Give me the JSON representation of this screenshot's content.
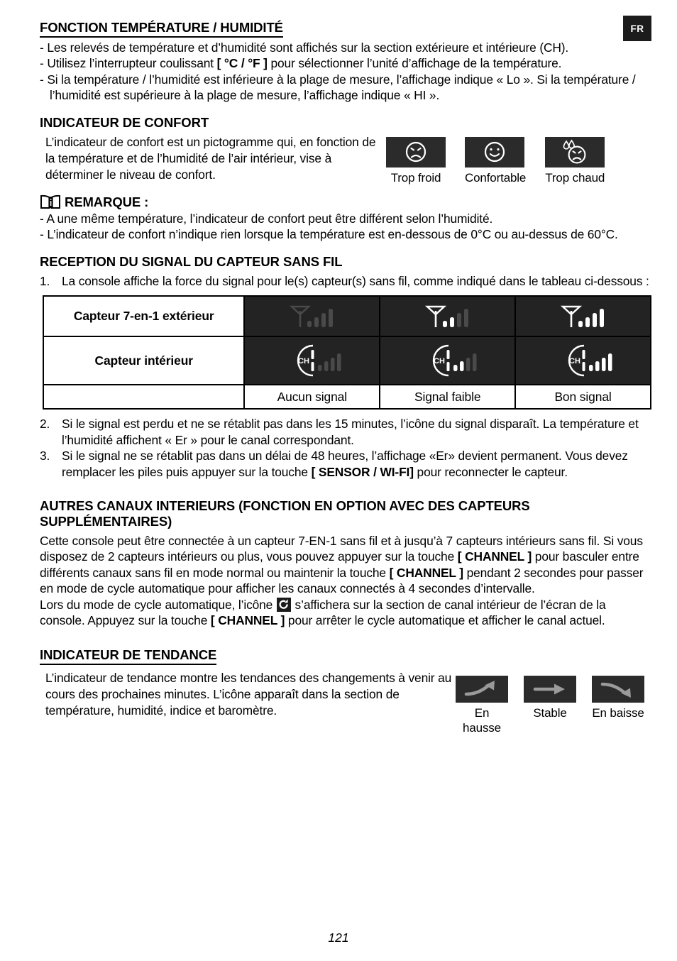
{
  "lang_badge": "FR",
  "page_number": "121",
  "temp_humidity": {
    "heading": "FONCTION TEMPÉRATURE / HUMIDITÉ",
    "bullets": [
      {
        "pre": "- Les relevés de température et d’humidité sont affichés sur la section extérieure et intérieure (CH).",
        "bold": "",
        "post": ""
      },
      {
        "pre": "- Utilisez l’interrupteur coulissant ",
        "bold": "[ °C / °F ]",
        "post": " pour sélectionner l’unité d’affichage de la température."
      },
      {
        "pre": "- Si la température / l’humidité est inférieure à la plage de mesure, l’affichage indique « Lo ». Si la température / l’humidité est supérieure à la plage de mesure, l’affichage indique « HI ».",
        "bold": "",
        "post": ""
      }
    ]
  },
  "comfort": {
    "heading": "INDICATEUR DE CONFORT",
    "description": "L’indicateur de confort est un pictogramme qui, en fonction de la température et de l’humidité de l’air intérieur, vise à déterminer le niveau de confort.",
    "items": [
      {
        "icon": "sad-face-icon",
        "label": "Trop froid"
      },
      {
        "icon": "happy-face-icon",
        "label": "Confortable"
      },
      {
        "icon": "sad-face-sweat-icon",
        "label": "Trop chaud"
      }
    ]
  },
  "remarque": {
    "icon": "manual-book-info-icon",
    "title": "REMARQUE :",
    "bullets": [
      "- A une même température, l’indicateur de confort peut être différent selon l’humidité.",
      "- L’indicateur de confort n’indique rien lorsque la température est en-dessous de 0°C ou au-dessus de 60°C."
    ]
  },
  "signal_reception": {
    "heading": "RECEPTION DU SIGNAL DU CAPTEUR SANS FIL",
    "items": [
      {
        "num": "1.",
        "pre": "La console affiche la force du signal pour le(s) capteur(s) sans fil, comme indiqué dans le tableau ci-dessous :",
        "bold": "",
        "post": ""
      },
      {
        "num": "2.",
        "pre": "Si le signal est perdu et ne se rétablit pas dans les 15 minutes, l’icône du signal disparaît. La température et l’humidité affichent « Er » pour le canal correspondant.",
        "bold": "",
        "post": ""
      },
      {
        "num": "3.",
        "pre": "Si le signal ne se rétablit pas dans un délai de 48 heures, l’affichage «Er» devient permanent. Vous devez remplacer les piles puis appuyer sur la touche ",
        "bold": "[ SENSOR / WI-FI]",
        "post": " pour reconnecter le capteur."
      }
    ],
    "table": {
      "rows": [
        {
          "label": "Capteur 7-en-1 extérieur",
          "icon": "antenna-signal-icon",
          "levels": [
            0,
            2,
            4
          ]
        },
        {
          "label": "Capteur intérieur",
          "icon": "channel-signal-icon",
          "levels": [
            0,
            2,
            4
          ]
        }
      ],
      "captions": [
        "Aucun signal",
        "Signal faible",
        "Bon signal"
      ]
    }
  },
  "other_channels": {
    "heading_line1": "AUTRES CANAUX INTERIEURS (FONCTION EN OPTION AVEC DES CAPTEURS",
    "heading_line2": "SUPPLÉMENTAIRES)",
    "para1_a": "Cette console peut être connectée à un capteur 7-EN-1 sans fil et à jusqu’à 7 capteurs intérieurs sans fil. Si vous disposez de 2 capteurs intérieurs ou plus, vous pouvez appuyer sur la touche ",
    "para1_b1": "[ CHANNEL ]",
    "para1_c": " pour basculer entre différents canaux sans fil en mode normal ou maintenir la touche ",
    "para1_b2": "[ CHANNEL ]",
    "para1_d": " pendant 2 secondes pour passer en mode de cycle automatique pour afficher les canaux connectés à 4 secondes d’intervalle.",
    "para2_a": "Lors du mode de cycle automatique, l’icône ",
    "para2_icon": "auto-cycle-icon",
    "para2_b": " s’affichera sur la section de canal intérieur de l’écran de la console. Appuyez sur la touche ",
    "para2_bold": "[ CHANNEL ]",
    "para2_c": " pour arrêter le cycle automatique et afficher le canal actuel."
  },
  "trend": {
    "heading": "INDICATEUR DE TENDANCE",
    "description": "L’indicateur de tendance montre les tendances des changements à venir au cours des prochaines minutes. L’icône apparaît dans la section de température, humidité, indice et baromètre.",
    "items": [
      {
        "icon": "arrow-rising-icon",
        "label": "En hausse"
      },
      {
        "icon": "arrow-steady-icon",
        "label": "Stable"
      },
      {
        "icon": "arrow-falling-icon",
        "label": "En baisse"
      }
    ]
  },
  "colors": {
    "icon_box_bg": "#2b2b2b",
    "table_cell_bg": "#232323",
    "icon_active": "#ffffff",
    "icon_inactive": "#4a4a4a",
    "badge_bg": "#1c1c1c"
  }
}
